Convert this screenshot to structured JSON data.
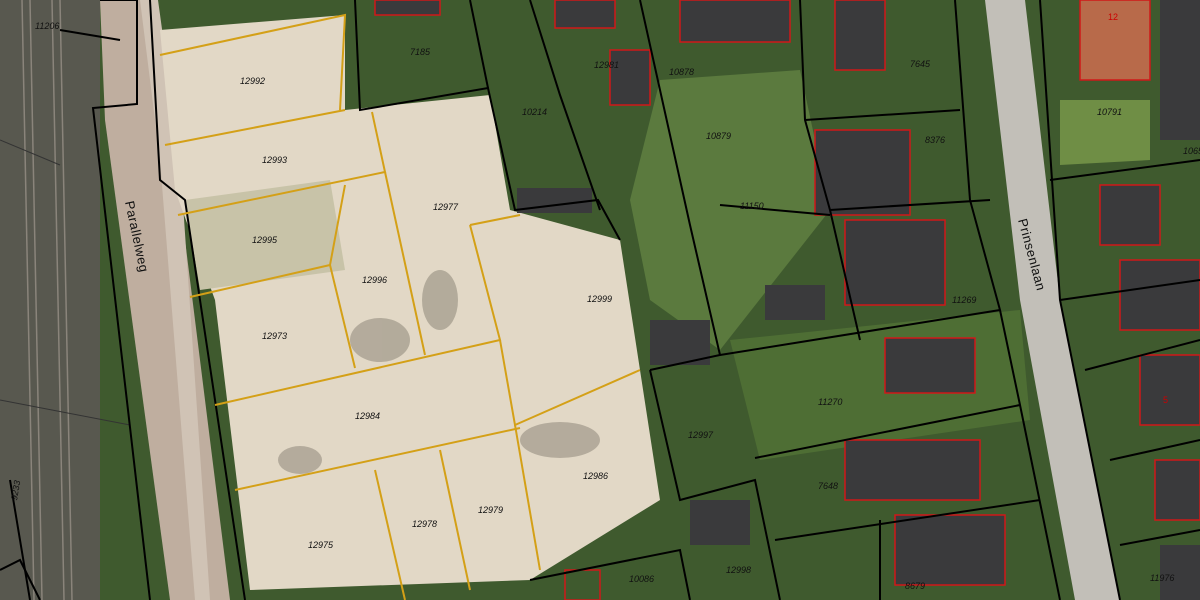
{
  "map": {
    "colors": {
      "black_boundary": "#000000",
      "gold_boundary": "#d4a017",
      "building_outline": "#d01818",
      "vegetation": "#3f5a2e",
      "sand": "#e2d8c6",
      "road": "#bfbdb6",
      "rail": "#6f6a63"
    },
    "streets": {
      "parallelweg": "Parallelweg",
      "prinsenlaan": "Prinsenlaan"
    },
    "parcels": {
      "p11206": "11206",
      "p12992": "12992",
      "p7185": "7185",
      "p12993": "12993",
      "p12977": "12977",
      "p12995": "12995",
      "p12996": "12996",
      "p12999": "12999",
      "p12973": "12973",
      "p12984": "12984",
      "p12986": "12986",
      "p12997": "12997",
      "p12975": "12975",
      "p12978": "12978",
      "p12979": "12979",
      "p10086": "10086",
      "p12998": "12998",
      "p10214": "10214",
      "p12981": "12981",
      "p10878": "10878",
      "p10879": "10879",
      "p11150": "11150",
      "p7645": "7645",
      "p8376": "8376",
      "p11269": "11269",
      "p11270": "11270",
      "p7648": "7648",
      "p8679": "8679",
      "p10791": "10791",
      "p1065": "1065",
      "p11976": "11976",
      "p9233": "9233"
    },
    "house_numbers": {
      "h12": "12",
      "h5": "5"
    }
  }
}
